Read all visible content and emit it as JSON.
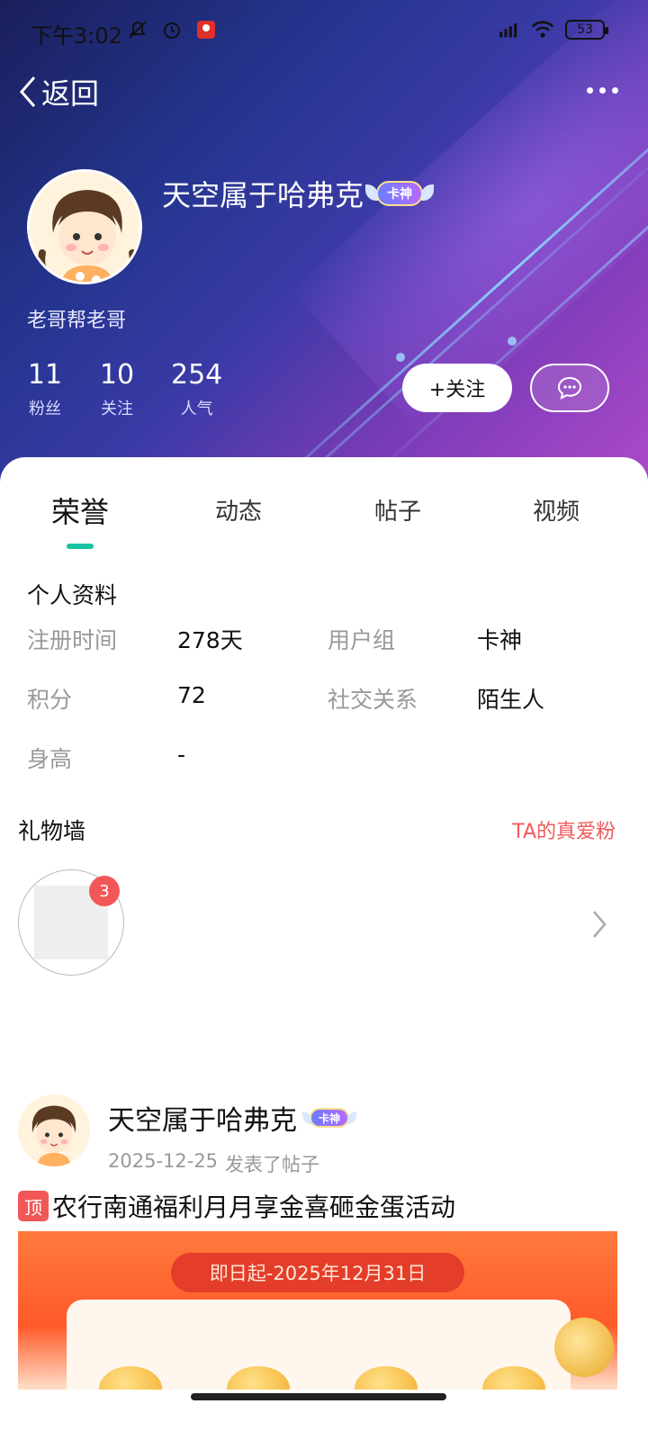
{
  "status_bar": {
    "time": "下午3:02",
    "battery": "53",
    "icons_left": [
      "bell-off-icon",
      "alarm-icon",
      "app-notification-icon"
    ],
    "icons_right": [
      "hd-signal-icon",
      "wifi-icon",
      "battery-icon"
    ]
  },
  "nav": {
    "back_label": "返回"
  },
  "profile": {
    "username": "天空属于哈弗克",
    "badge": "卡神",
    "bio": "老哥帮老哥",
    "stats": [
      {
        "num": "11",
        "label": "粉丝"
      },
      {
        "num": "10",
        "label": "关注"
      },
      {
        "num": "254",
        "label": "人气"
      }
    ],
    "follow_label": "+关注"
  },
  "tabs": [
    {
      "label": "荣誉",
      "active": true
    },
    {
      "label": "动态",
      "active": false
    },
    {
      "label": "帖子",
      "active": false
    },
    {
      "label": "视频",
      "active": false
    }
  ],
  "personal_info": {
    "title": "个人资料",
    "rows": [
      {
        "label1": "注册时间",
        "value1": "278天",
        "label2": "用户组",
        "value2": "卡神"
      },
      {
        "label1": "积分",
        "value1": "72",
        "label2": "社交关系",
        "value2": "陌生人"
      },
      {
        "label1": "身高",
        "value1": "-",
        "label2": "",
        "value2": ""
      }
    ]
  },
  "gift_wall": {
    "title": "礼物墙",
    "link": "TA的真爱粉",
    "count": "3"
  },
  "post": {
    "author": "天空属于哈弗克",
    "badge": "卡神",
    "date": "2025-12-25",
    "action": "发表了帖子",
    "pin_tag": "顶",
    "title": "农行南通福利月月享金喜砸金蛋活动",
    "image_banner": "即日起-2025年12月31日"
  },
  "colors": {
    "accent": "#19c2a0",
    "link_red": "#f05a5a",
    "badge_red": "#f25757"
  }
}
